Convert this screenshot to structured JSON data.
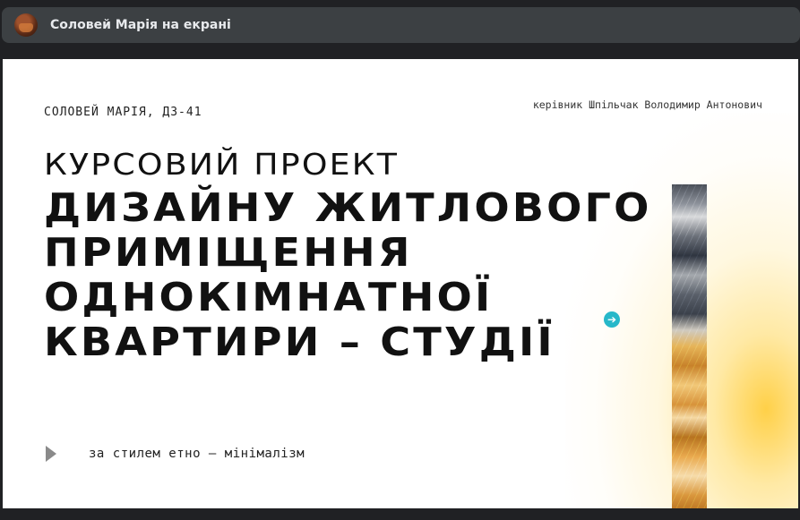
{
  "header": {
    "title": "Соловей Марія на екрані"
  },
  "slide": {
    "author": "СОЛОВЕЙ МАРІЯ, ДЗ-41",
    "supervisor": "керівник Шпільчак Володимир Антонович",
    "heading_top": "КУРСОВИЙ ПРОЕКТ",
    "heading_lines": [
      "ДИЗАЙНУ ЖИТЛОВОГО",
      "ПРИМІЩЕННЯ",
      "ОДНОКІМНАТНОЇ",
      "КВАРТИРИ – СТУДІЇ"
    ],
    "style_note": "за стилем етно – мінімалізм"
  },
  "icons": {
    "next": "arrow-right-icon",
    "play": "play-icon"
  },
  "colors": {
    "topbar": "#3c4043",
    "accent_cyan": "#27b8c9",
    "glow": "#ffc828"
  }
}
